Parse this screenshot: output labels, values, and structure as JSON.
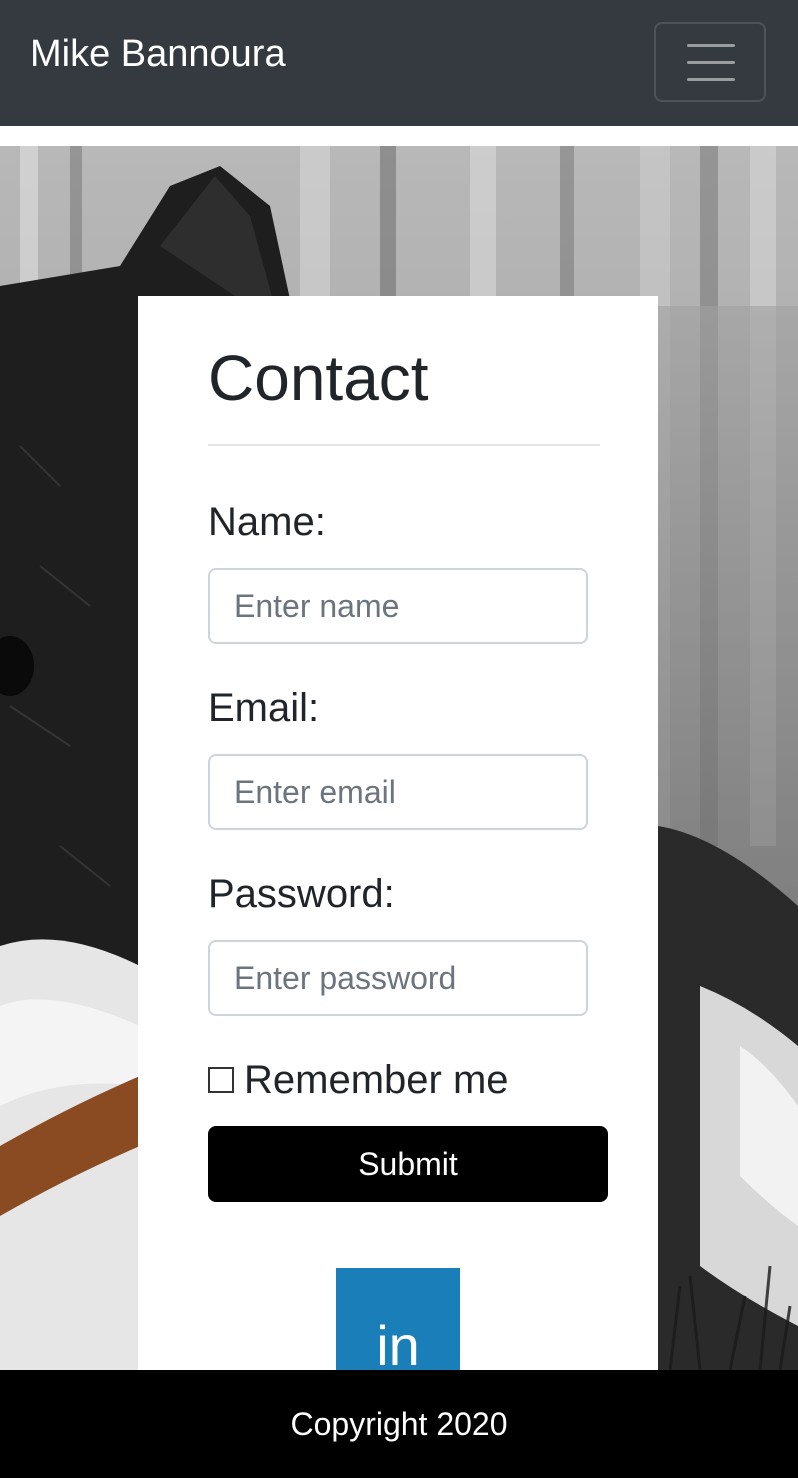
{
  "navbar": {
    "brand": "Mike Bannoura",
    "toggler_icon": "hamburger-menu-icon",
    "background": "#343a40"
  },
  "hero": {
    "image": "black-and-white-dog-photo"
  },
  "contact": {
    "title": "Contact",
    "name_label": "Name:",
    "name_placeholder": "Enter name",
    "name_value": "",
    "email_label": "Email:",
    "email_placeholder": "Enter email",
    "email_value": "",
    "password_label": "Password:",
    "password_placeholder": "Enter password",
    "password_value": "",
    "remember_label": "Remember me",
    "remember_checked": false,
    "submit_label": "Submit"
  },
  "social": {
    "linkedin_text": "in",
    "linkedin_icon": "linkedin-icon",
    "linkedin_color": "#1a7fb8"
  },
  "footer": {
    "text": "Copyright 2020"
  }
}
